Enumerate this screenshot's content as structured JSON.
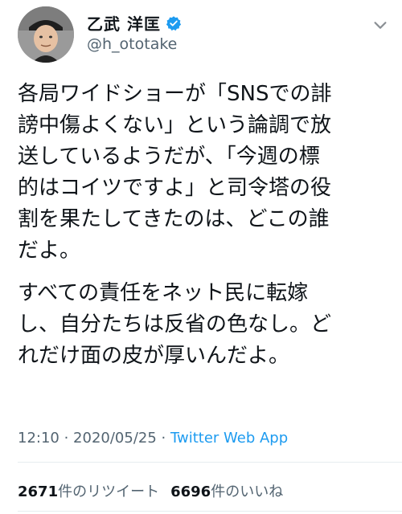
{
  "author": {
    "display_name": "乙武 洋匡",
    "handle": "@h_ototake",
    "verified": true,
    "avatar_icon": "profile-photo",
    "verified_icon": "verified-badge-icon",
    "more_icon": "chevron-down-icon"
  },
  "tweet": {
    "paragraphs": [
      "各局ワイドショーが「SNSでの誹\n謗中傷よくない」という論調で放\n送しているようだが、「今週の標\n的はコイツですよ」と司令塔の役\n割を果たしてきたのは、どこの誰\nだよ。",
      "すべての責任をネット民に転嫁\nし、自分たちは反省の色なし。ど\nれだけ面の皮が厚いんだよ。"
    ],
    "time": "12:10",
    "separator": " · ",
    "date": "2020/05/25",
    "separator2": " · ",
    "source": "Twitter Web App"
  },
  "stats": {
    "retweets_count": "2671",
    "retweets_label": "件のリツイート",
    "likes_count": "6696",
    "likes_label": "件のいいね"
  },
  "colors": {
    "link": "#1d9bf0",
    "text": "#0f1419",
    "secondary": "#536471"
  }
}
